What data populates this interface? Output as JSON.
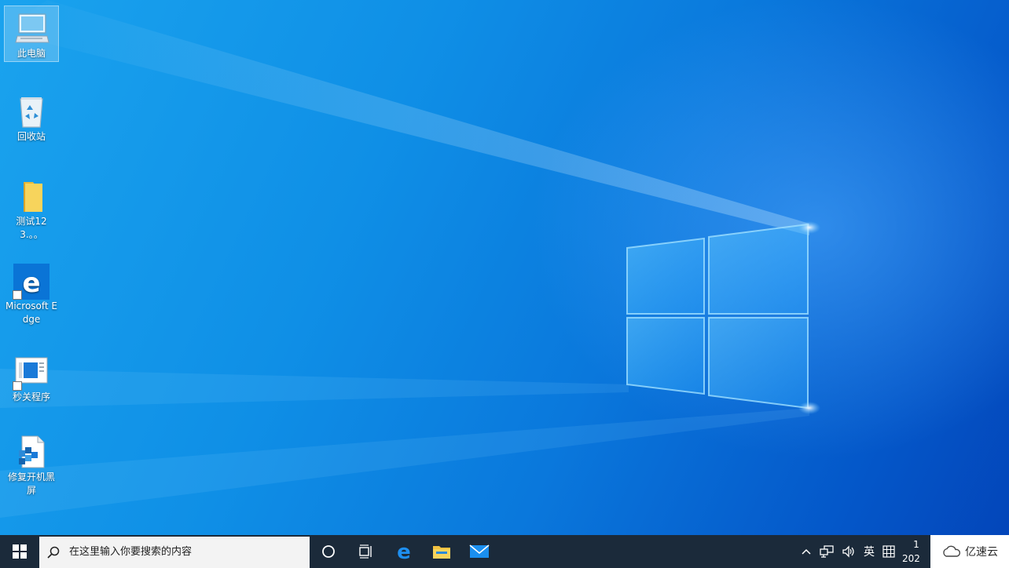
{
  "desktop": {
    "icons": [
      {
        "label": "此电脑",
        "icon": "this-pc-icon"
      },
      {
        "label": "回收站",
        "icon": "recycle-bin-icon"
      },
      {
        "label": "测试123.。。",
        "icon": "folder-icon"
      },
      {
        "label": "Microsoft Edge",
        "icon": "edge-icon"
      },
      {
        "label": "秒关程序",
        "icon": "program-shortcut-icon"
      },
      {
        "label": "修复开机黑屏",
        "icon": "repair-file-icon"
      }
    ]
  },
  "taskbar": {
    "search_placeholder": "在这里输入你要搜索的内容",
    "buttons": [
      "cortana-icon",
      "task-view-icon",
      "edge-icon",
      "file-explorer-icon",
      "mail-icon"
    ],
    "tray": {
      "ime_label": "英",
      "clock_time": "1",
      "clock_date": "202"
    }
  },
  "watermark": {
    "text": "亿速云"
  },
  "colors": {
    "desktop_top": "#1aa3ee",
    "desktop_bottom": "#0344b8",
    "taskbar": "#1b2a3a",
    "search_bg": "#f3f3f3"
  }
}
